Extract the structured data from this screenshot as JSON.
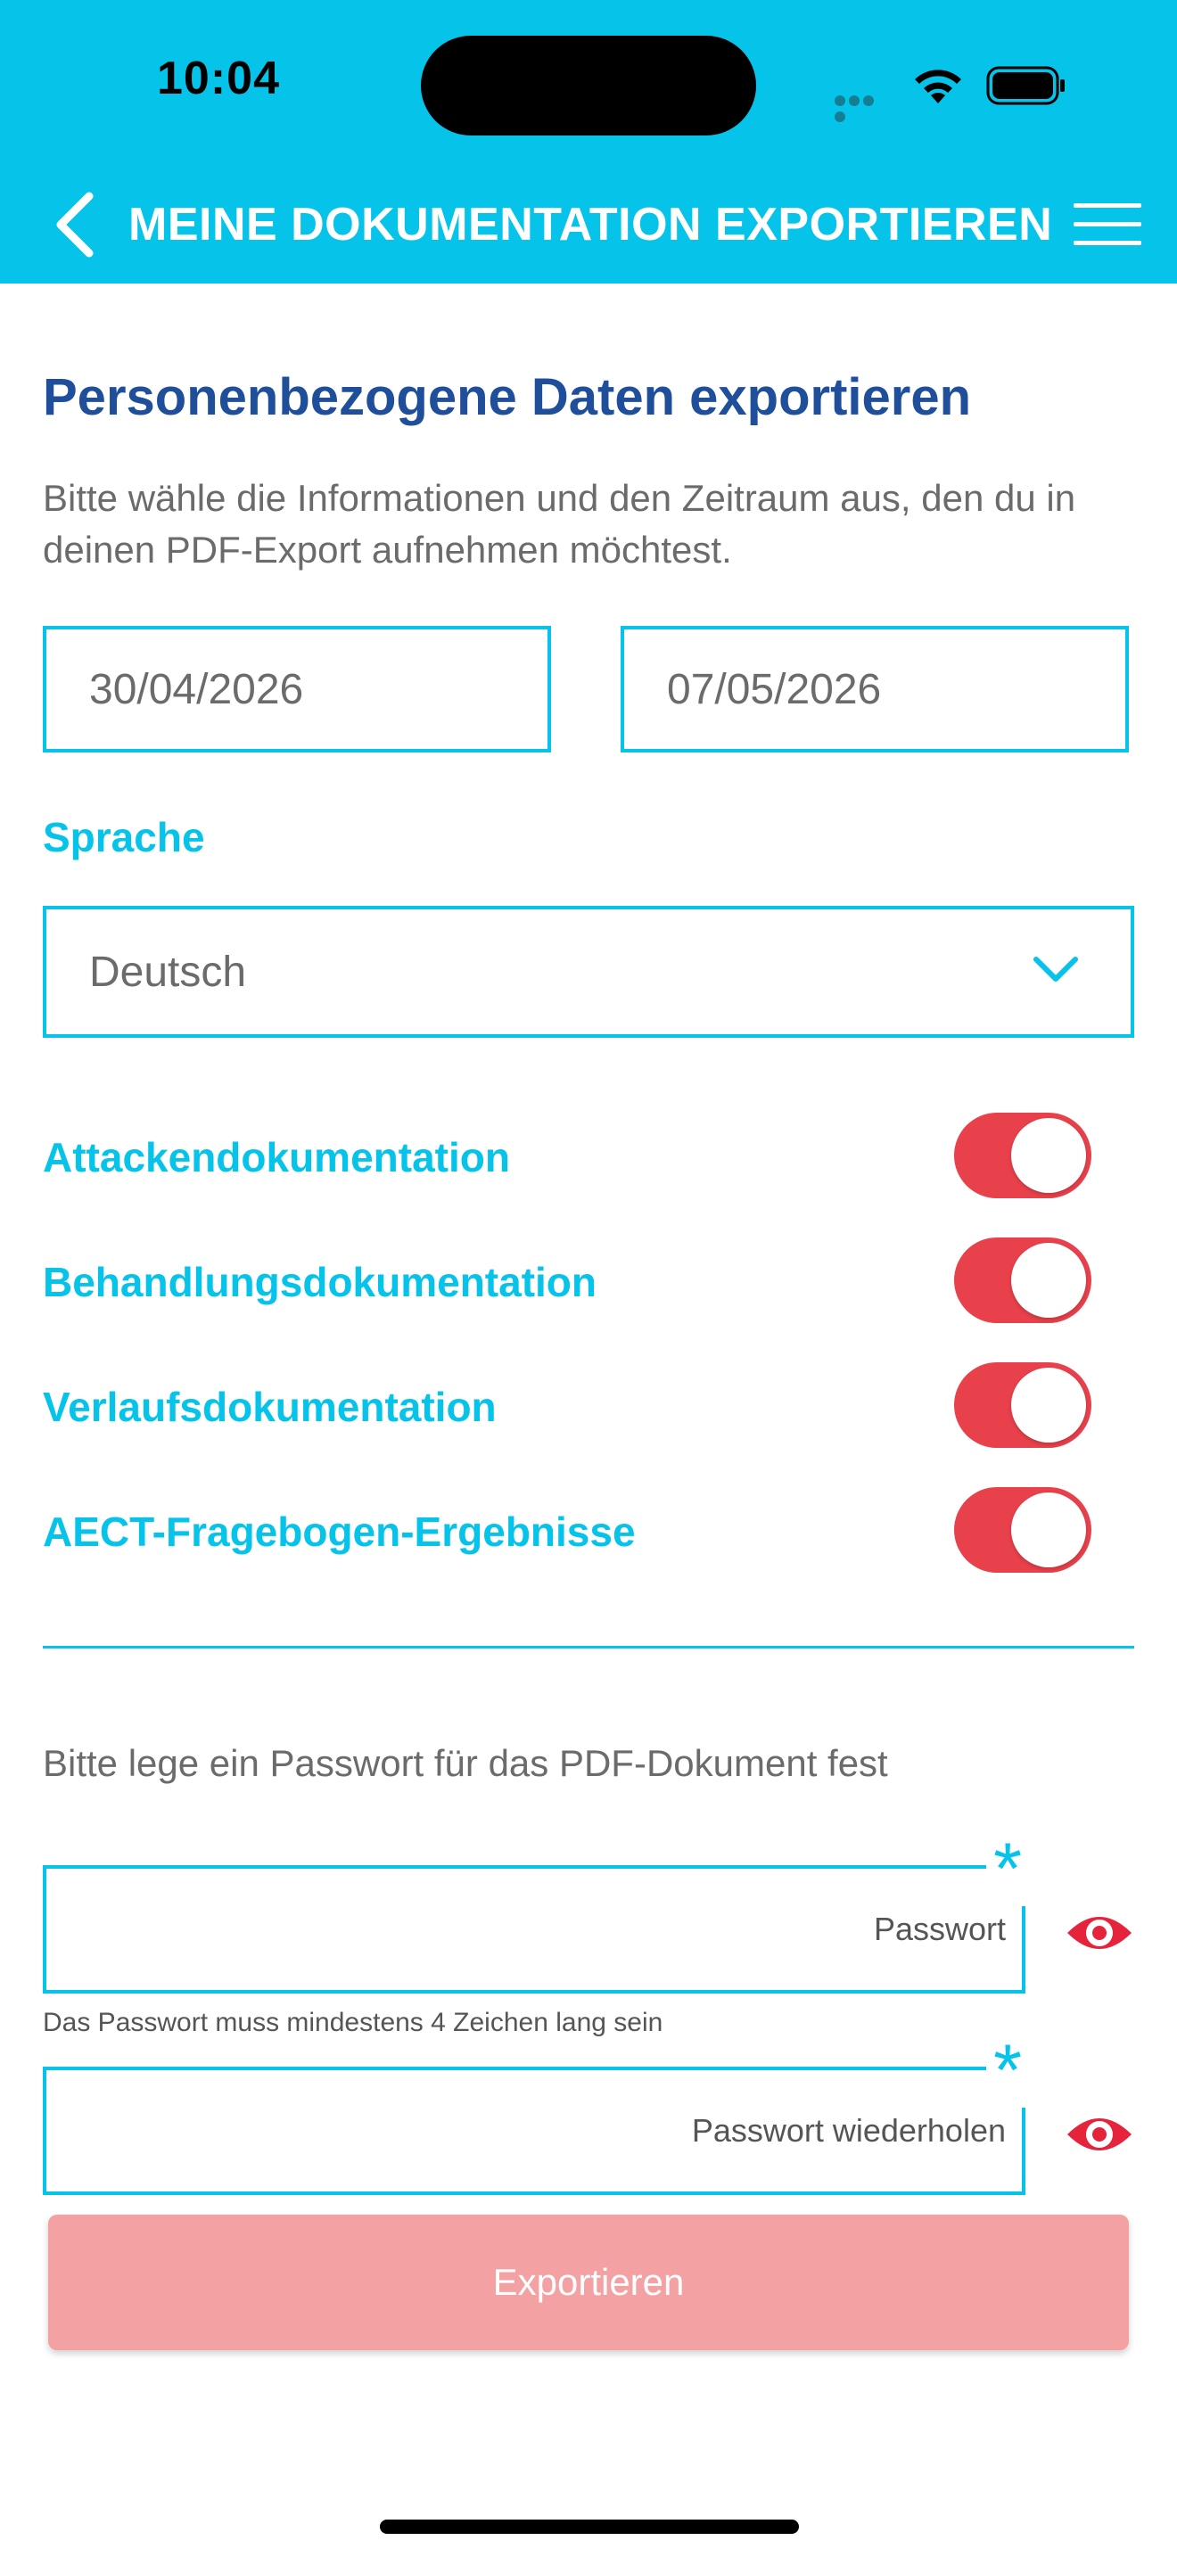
{
  "status_bar": {
    "time": "10:04"
  },
  "header": {
    "title": "MEINE DOKUMENTATION EXPORTIEREN",
    "back_icon": "chevron-left-icon",
    "menu_icon": "hamburger-menu-icon",
    "background_color": "#06c3e9"
  },
  "export": {
    "title": "Personenbezogene Daten exportieren",
    "description": "Bitte wähle die Informationen und den Zeitraum aus, den du in deinen PDF-Export aufnehmen möchtest.",
    "date_from": "30/04/2026",
    "date_to": "07/05/2026"
  },
  "language": {
    "label": "Sprache",
    "selected": "Deutsch"
  },
  "toggles": [
    {
      "label": "Attackendokumentation",
      "on": true
    },
    {
      "label": "Behandlungsdokumentation",
      "on": true
    },
    {
      "label": "Verlaufsdokumentation",
      "on": true
    },
    {
      "label": "AECT-Fragebogen-Ergebnisse",
      "on": true
    }
  ],
  "password": {
    "instruction": "Bitte lege ein Passwort für das PDF-Dokument fest",
    "placeholder": "Passwort",
    "hint": "Das Passwort muss mindestens 4 Zeichen lang sein",
    "repeat_placeholder": "Passwort wiederholen",
    "required_marker": "*"
  },
  "actions": {
    "export_label": "Exportieren"
  },
  "colors": {
    "accent": "#06c3e9",
    "title": "#1f4e9a",
    "toggle_on": "#e8414b",
    "export_button": "#f4a1a4"
  }
}
